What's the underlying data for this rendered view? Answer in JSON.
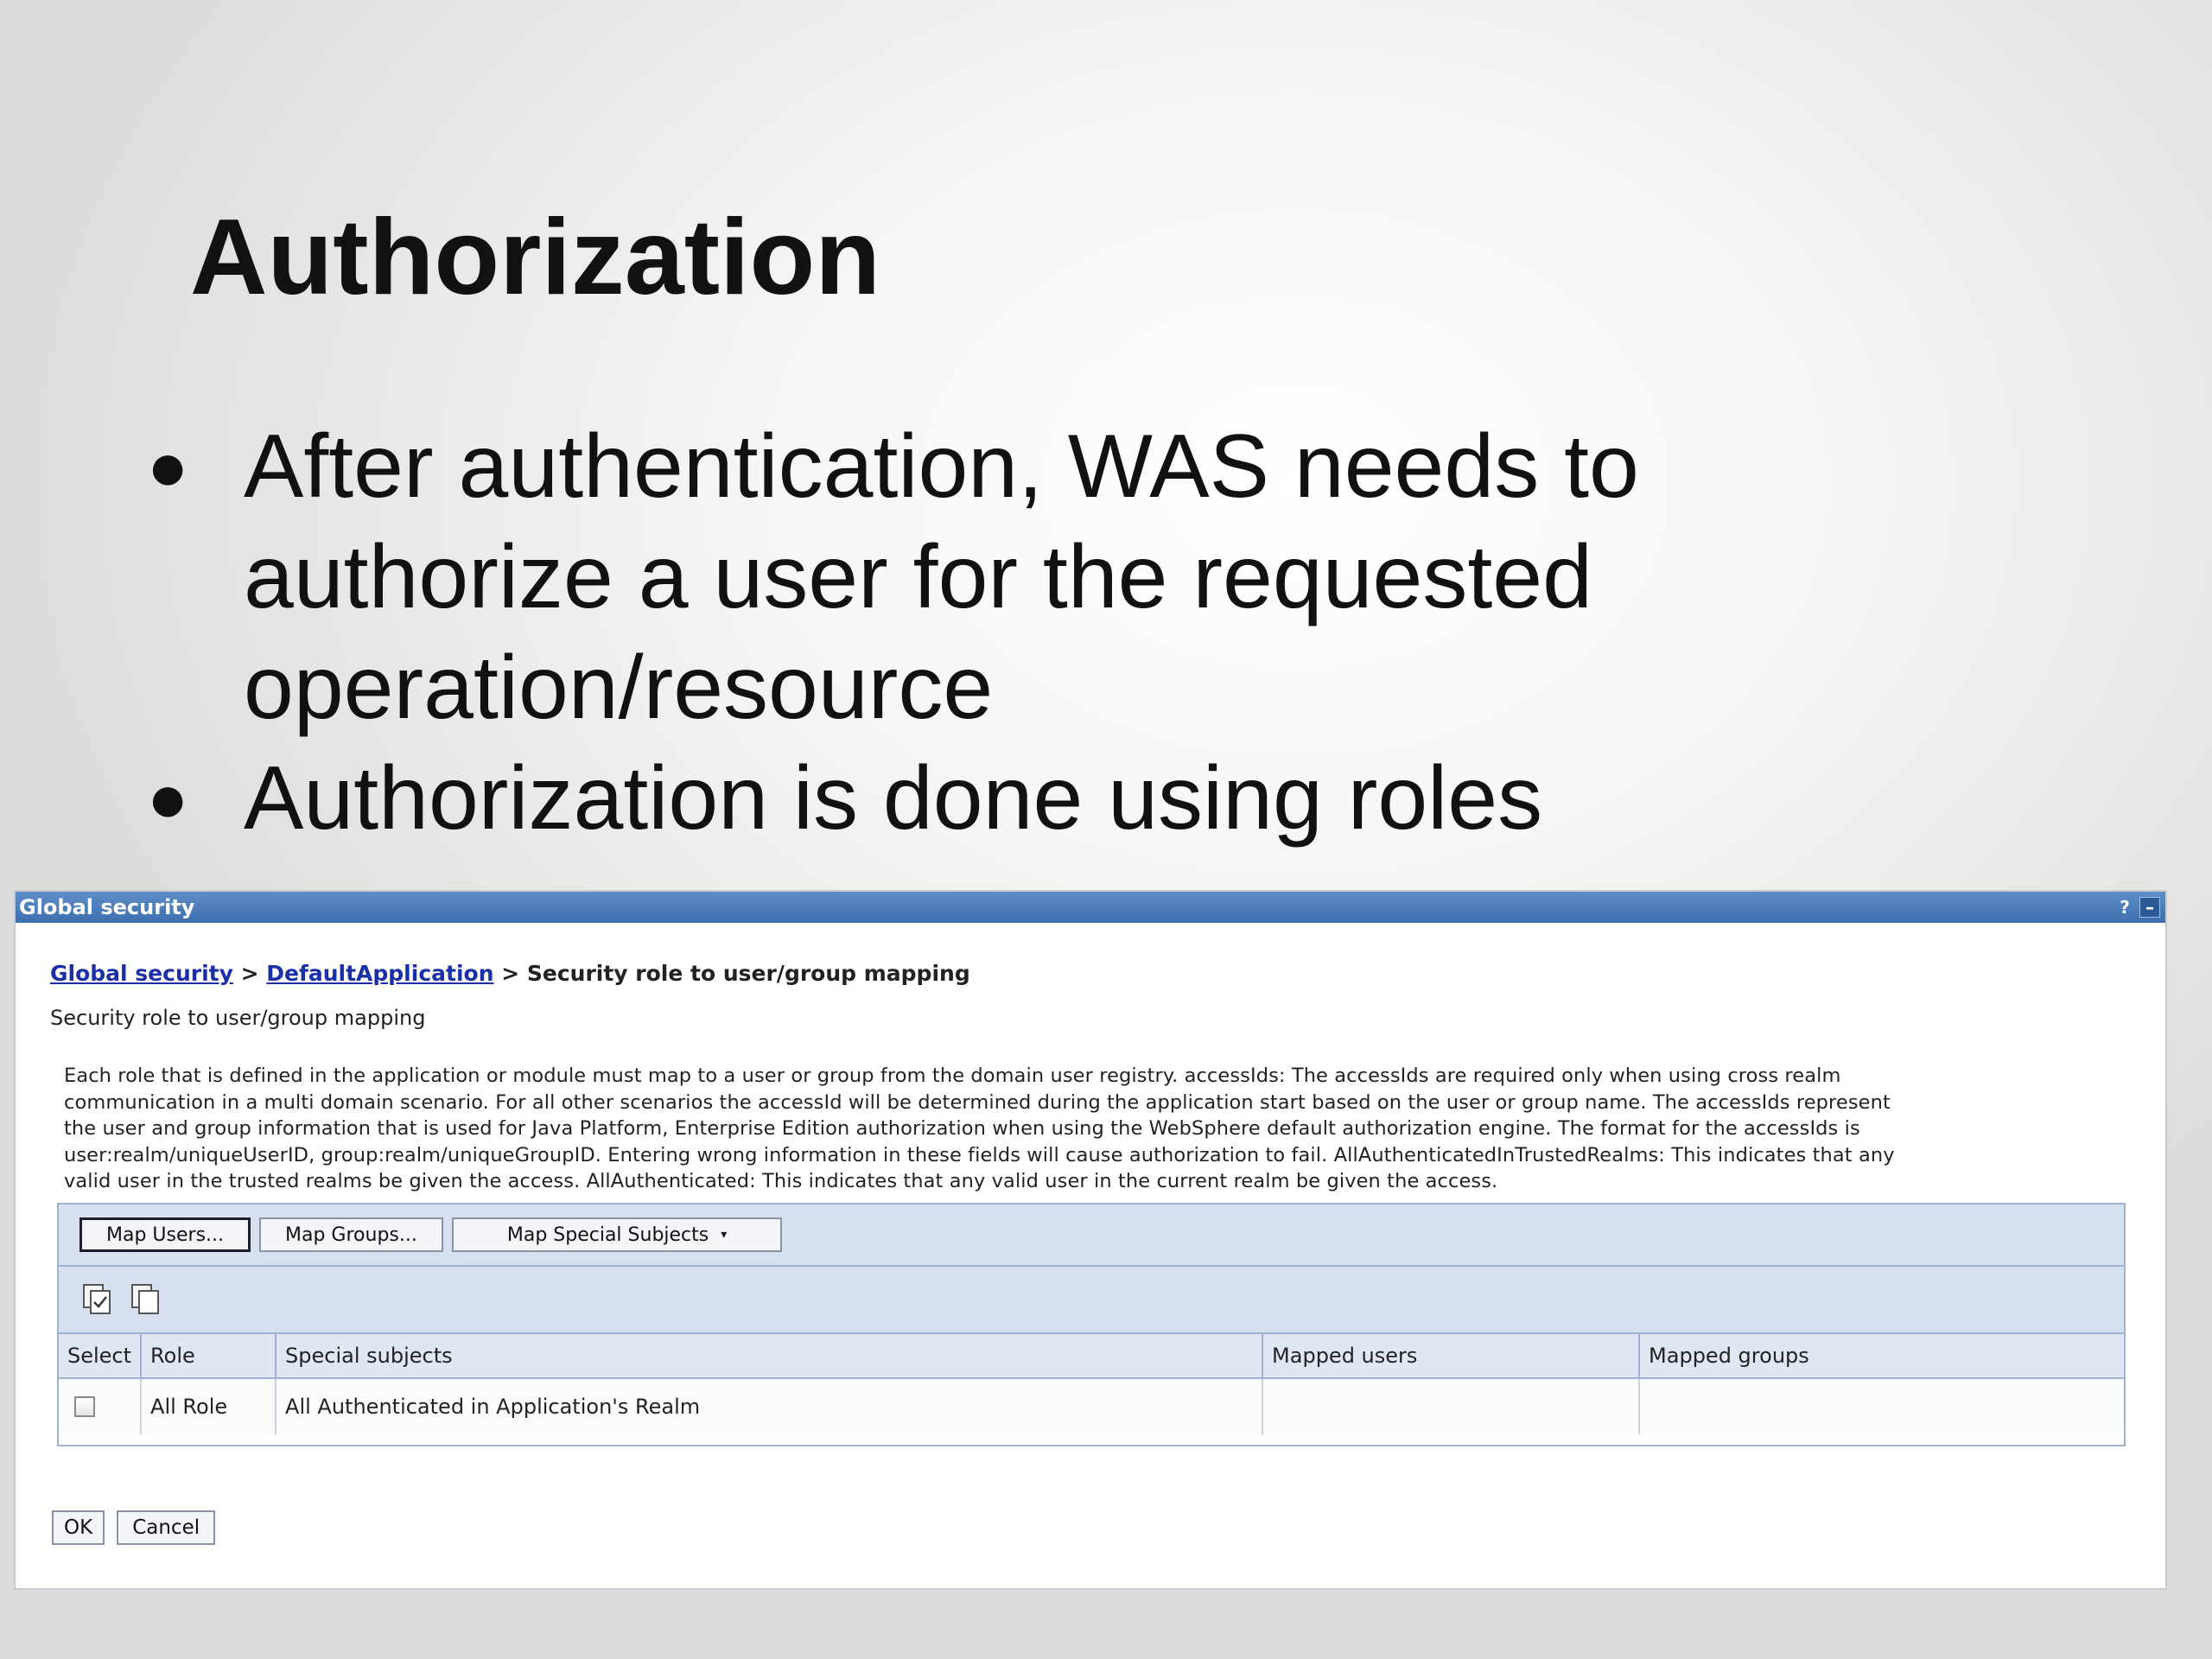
{
  "slide": {
    "title": "Authorization",
    "bullets": [
      {
        "lines": [
          "After authentication, WAS needs to",
          "authorize a user for the requested",
          "operation/resource"
        ]
      },
      {
        "lines": [
          "Authorization is done using roles"
        ]
      }
    ]
  },
  "window": {
    "title": "Global security",
    "help_label": "?",
    "minimize_label": "–"
  },
  "breadcrumb": {
    "link1": "Global security",
    "sep1": " > ",
    "link2": "DefaultApplication",
    "sep2": " > ",
    "current": "Security role to user/group mapping"
  },
  "page_subtitle": "Security role to user/group mapping",
  "description_lines": [
    "Each role that is defined in the application or module must map to a user or group from the domain user registry. accessIds: The accessIds are required only when using cross realm",
    "communication in a multi domain scenario. For all other scenarios the accessId will be determined during the application start based on the user or group name. The accessIds represent",
    "the user and group information that is used for Java Platform, Enterprise Edition authorization when using the WebSphere default authorization engine. The format for the accessIds is",
    "user:realm/uniqueUserID, group:realm/uniqueGroupID. Entering wrong information in these fields will cause authorization to fail. AllAuthenticatedInTrustedRealms: This indicates that any",
    "valid user in the trusted realms be given the access. AllAuthenticated: This indicates that any valid user in the current realm be given the access."
  ],
  "toolbar": {
    "map_users": "Map Users...",
    "map_groups": "Map Groups...",
    "map_special": "Map Special Subjects",
    "caret": "▾"
  },
  "table": {
    "headers": [
      "Select",
      "Role",
      "Special subjects",
      "Mapped users",
      "Mapped groups"
    ],
    "rows": [
      {
        "role": "All Role",
        "special_subjects": "All Authenticated in Application's Realm",
        "mapped_users": "",
        "mapped_groups": ""
      }
    ]
  },
  "footer": {
    "ok": "OK",
    "cancel": "Cancel"
  },
  "colors": {
    "titlebar": "#4a7cbd",
    "link": "#1b2fa6",
    "toolbar_bg": "#d6e0ee"
  }
}
